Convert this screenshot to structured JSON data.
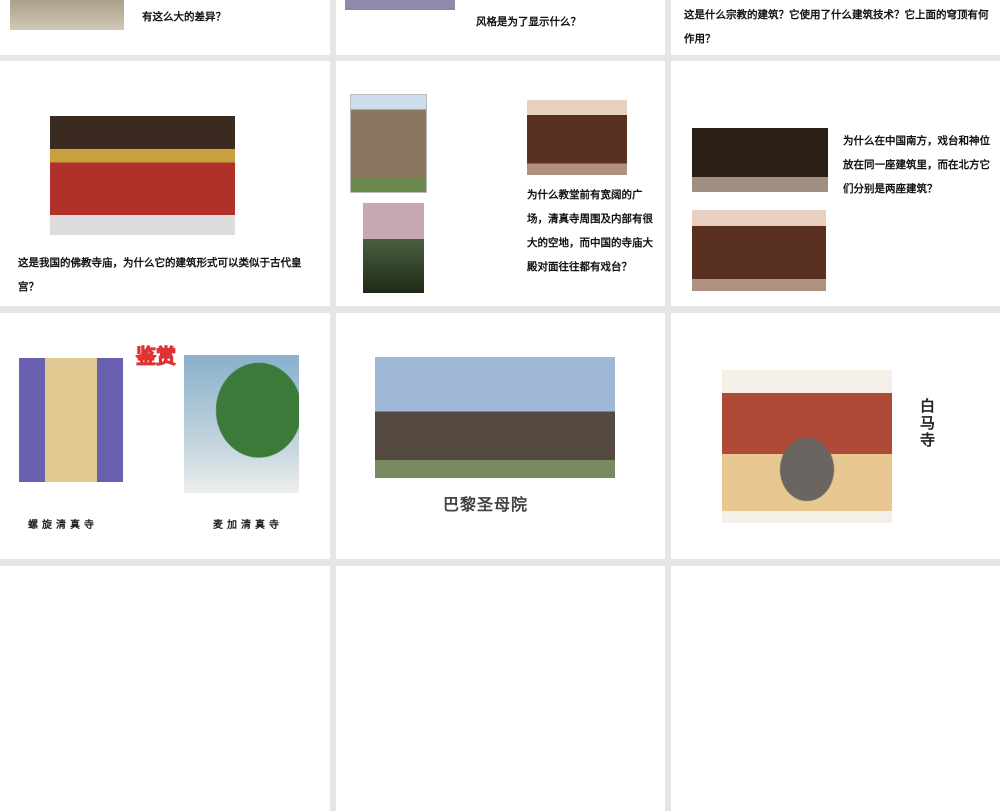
{
  "slides": [
    {
      "text": "有这么大的差异？"
    },
    {
      "text": "风格是为了显示什么？"
    },
    {
      "text": "这是什么宗教的建筑？它使用了什么建筑技术？它上面的穹顶有何作用？"
    },
    {
      "text": "这是我国的佛教寺庙，为什么它的建筑形式可以类似于古代皇宫？"
    },
    {
      "text": "为什么教堂前有宽阔的广场，清真寺周围及内部有很大的空地，而中国的寺庙大殿对面往往都有戏台？"
    },
    {
      "text": "为什么在中国南方，戏台和神位放在同一座建筑里，而在北方它们分别是两座建筑？"
    },
    {
      "title": "鉴赏",
      "label_left": "螺旋清真寺",
      "label_right": "麦加清真寺"
    },
    {
      "title": "巴黎圣母院"
    },
    {
      "title": "白马寺"
    }
  ],
  "colors": {
    "background": "#e6e6e6",
    "title_red": "#d33"
  }
}
